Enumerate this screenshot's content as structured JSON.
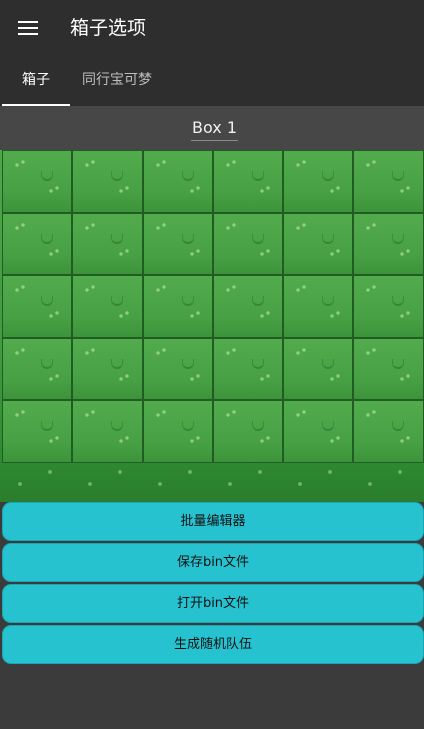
{
  "appbar": {
    "menu_icon": "hamburger-menu-icon",
    "title": "箱子选项"
  },
  "tabs": [
    {
      "label": "箱子",
      "active": true
    },
    {
      "label": "同行宝可梦",
      "active": false
    }
  ],
  "box": {
    "name": "Box 1",
    "slot_count": 30
  },
  "actions": [
    {
      "label": "批量编辑器"
    },
    {
      "label": "保存bin文件"
    },
    {
      "label": "打开bin文件"
    },
    {
      "label": "生成随机队伍"
    }
  ],
  "colors": {
    "appbar": "#2e2e2e",
    "background": "#3b3b3b",
    "accent": "#26c2d0",
    "grass": "#4ea74a"
  }
}
